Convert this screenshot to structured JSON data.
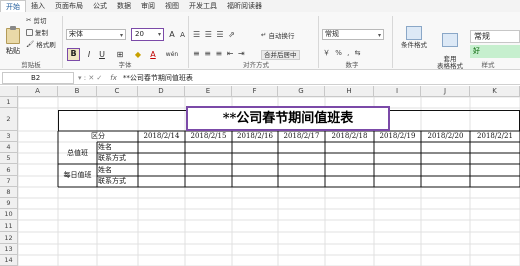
{
  "menu": [
    "开始",
    "插入",
    "页面布局",
    "公式",
    "数据",
    "审阅",
    "视图",
    "开发工具",
    "福昕阅读器"
  ],
  "clipboard": {
    "paste": "粘贴",
    "cut": "剪切",
    "copy": "复制",
    "format_painter": "格式刷",
    "group": "剪贴板"
  },
  "font": {
    "name": "宋体",
    "size": "20",
    "group": "字体",
    "grow": "A",
    "shrink": "A",
    "bold": "B",
    "italic": "I",
    "underline": "U",
    "font_color": "A",
    "lang": "wén"
  },
  "alignment": {
    "wrap": "自动换行",
    "merge": "合并后居中",
    "group": "对齐方式"
  },
  "number": {
    "format": "常规",
    "group": "数字",
    "symbols": "% ,"
  },
  "styles": {
    "conditional": "条件格式",
    "table_format": "套用\n表格格式",
    "normal": "常规",
    "good": "好",
    "group": "样式"
  },
  "formula_bar": {
    "cell": "B2",
    "fx": "fx",
    "content": "**公司春节期间值班表"
  },
  "columns": [
    "A",
    "B",
    "C",
    "D",
    "E",
    "F",
    "G",
    "H",
    "I",
    "J",
    "K"
  ],
  "rows": [
    "1",
    "2",
    "3",
    "4",
    "5",
    "6",
    "7",
    "8",
    "9",
    "10",
    "11",
    "12",
    "13",
    "14"
  ],
  "table": {
    "title": "**公司春节期间值班表",
    "area_label": "区分",
    "dates": [
      "2018/2/14",
      "2018/2/15",
      "2018/2/16",
      "2018/2/17",
      "2018/2/18",
      "2018/2/19",
      "2018/2/20",
      "2018/2/21"
    ],
    "groups": [
      {
        "name": "总值班",
        "fields": [
          "姓名",
          "联系方式"
        ]
      },
      {
        "name": "每日值班",
        "fields": [
          "姓名",
          "联系方式"
        ]
      }
    ]
  }
}
